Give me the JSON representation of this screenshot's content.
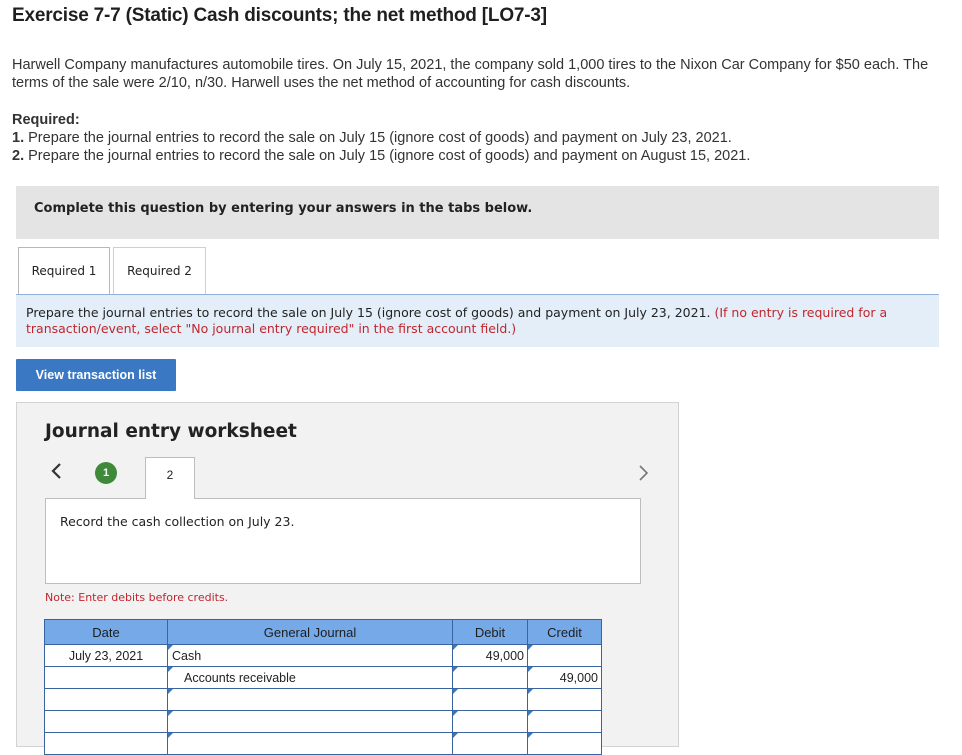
{
  "title": "Exercise 7-7 (Static) Cash discounts; the net method [LO7-3]",
  "intro": "Harwell Company manufactures automobile tires. On July 15, 2021, the company sold 1,000 tires to the Nixon Car Company for $50 each. The terms of the sale were 2/10, n/30. Harwell uses the net method of accounting for cash discounts.",
  "required": {
    "heading": "Required:",
    "items": [
      {
        "num": "1.",
        "text": "Prepare the journal entries to record the sale on July 15 (ignore cost of goods) and payment on July 23, 2021."
      },
      {
        "num": "2.",
        "text": "Prepare the journal entries to record the sale on July 15 (ignore cost of goods) and payment on August 15, 2021."
      }
    ]
  },
  "banner": "Complete this question by entering your answers in the tabs below.",
  "tabs": [
    "Required 1",
    "Required 2"
  ],
  "instruction": {
    "main": "Prepare the journal entries to record the sale on July 15 (ignore cost of goods) and payment on July 23, 2021.",
    "note": "(If no entry is required for a transaction/event, select \"No journal entry required\" in the first account field.)"
  },
  "view_button": "View transaction list",
  "worksheet": {
    "title": "Journal entry worksheet",
    "steps": [
      "1",
      "2"
    ],
    "record_text": "Record the cash collection on July 23.",
    "note": "Note: Enter debits before credits."
  },
  "journal": {
    "headers": {
      "date": "Date",
      "general_journal": "General Journal",
      "debit": "Debit",
      "credit": "Credit"
    },
    "rows": [
      {
        "date": "July 23, 2021",
        "account": "Cash",
        "debit": "49,000",
        "credit": ""
      },
      {
        "date": "",
        "account": "Accounts receivable",
        "debit": "",
        "credit": "49,000"
      },
      {
        "date": "",
        "account": "",
        "debit": "",
        "credit": ""
      },
      {
        "date": "",
        "account": "",
        "debit": "",
        "credit": ""
      },
      {
        "date": "",
        "account": "",
        "debit": "",
        "credit": ""
      }
    ]
  },
  "colors": {
    "accent": "#3a78c3",
    "step_active": "#3f8a3a",
    "note_red": "#c0262d",
    "table_header": "#76a9e8"
  },
  "icons": {
    "prev": "chevron-left-icon",
    "next": "chevron-right-icon"
  }
}
